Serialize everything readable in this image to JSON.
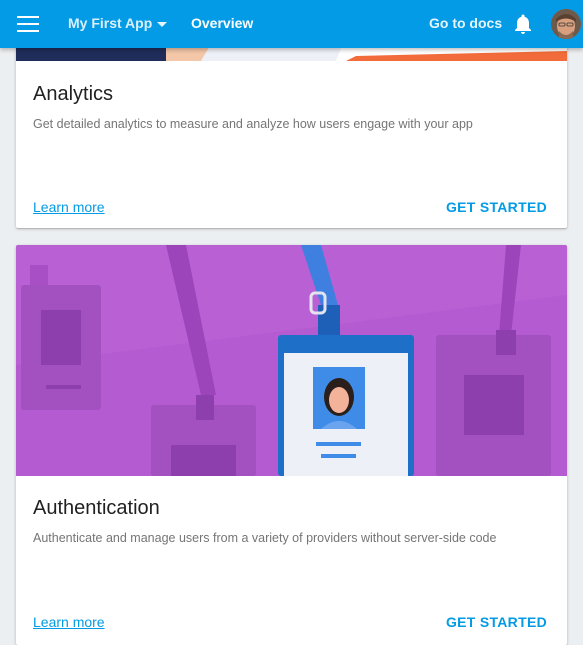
{
  "appbar": {
    "app_name": "My First App",
    "page": "Overview",
    "docs_link": "Go to docs",
    "bg_color": "#039be5"
  },
  "cards": [
    {
      "title": "Analytics",
      "description": "Get detailed analytics to measure and analyze how users engage with your app",
      "learn_more": "Learn more",
      "action": "GET STARTED"
    },
    {
      "title": "Authentication",
      "description": "Authenticate and manage users from a variety of providers without server-side code",
      "learn_more": "Learn more",
      "action": "GET STARTED",
      "hero_color": "#b55bd1"
    }
  ],
  "icons": [
    "menu-icon",
    "chevron-down-icon",
    "bell-icon",
    "avatar"
  ]
}
